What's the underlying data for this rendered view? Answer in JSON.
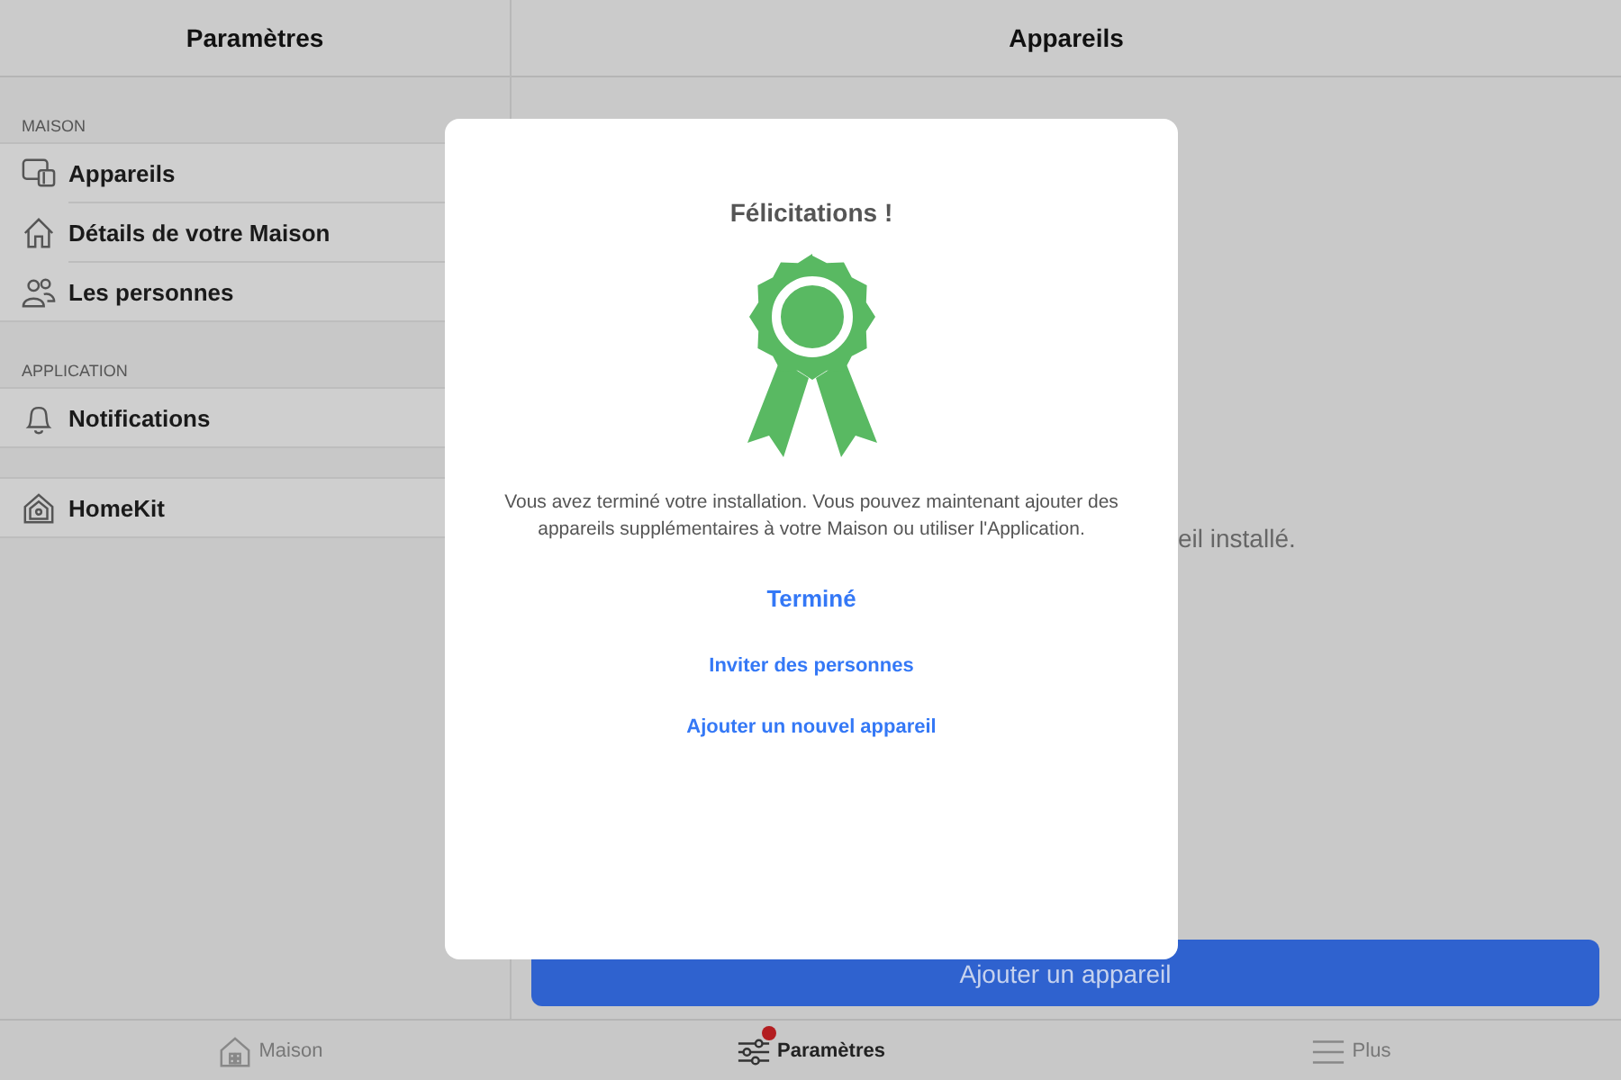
{
  "sidebar": {
    "title": "Paramètres",
    "sections": [
      {
        "header": "MAISON",
        "items": [
          {
            "label": "Appareils",
            "kind": "devices"
          },
          {
            "label": "Détails de votre Maison",
            "kind": "home"
          },
          {
            "label": "Les personnes",
            "kind": "people"
          }
        ]
      },
      {
        "header": "APPLICATION",
        "items": [
          {
            "label": "Notifications",
            "kind": "bell"
          }
        ]
      },
      {
        "items": [
          {
            "label": "HomeKit",
            "kind": "homekit"
          }
        ]
      }
    ]
  },
  "main": {
    "title": "Appareils",
    "empty_text": "eil installé.",
    "add_button": "Ajouter un appareil"
  },
  "dialog": {
    "title": "Félicitations !",
    "message": "Vous avez terminé votre installation. Vous pouvez maintenant ajouter des appareils supplémentaires à votre Maison ou utiliser l'Application.",
    "primary_action": "Terminé",
    "actions": [
      "Inviter des personnes",
      "Ajouter un nouvel appareil"
    ]
  },
  "tab_bar": [
    {
      "label": "Maison",
      "kind": "house",
      "selected": false,
      "badge": false
    },
    {
      "label": "Paramètres",
      "kind": "sliders",
      "selected": true,
      "badge": true
    },
    {
      "label": "Plus",
      "kind": "menu",
      "selected": false,
      "badge": false
    }
  ]
}
